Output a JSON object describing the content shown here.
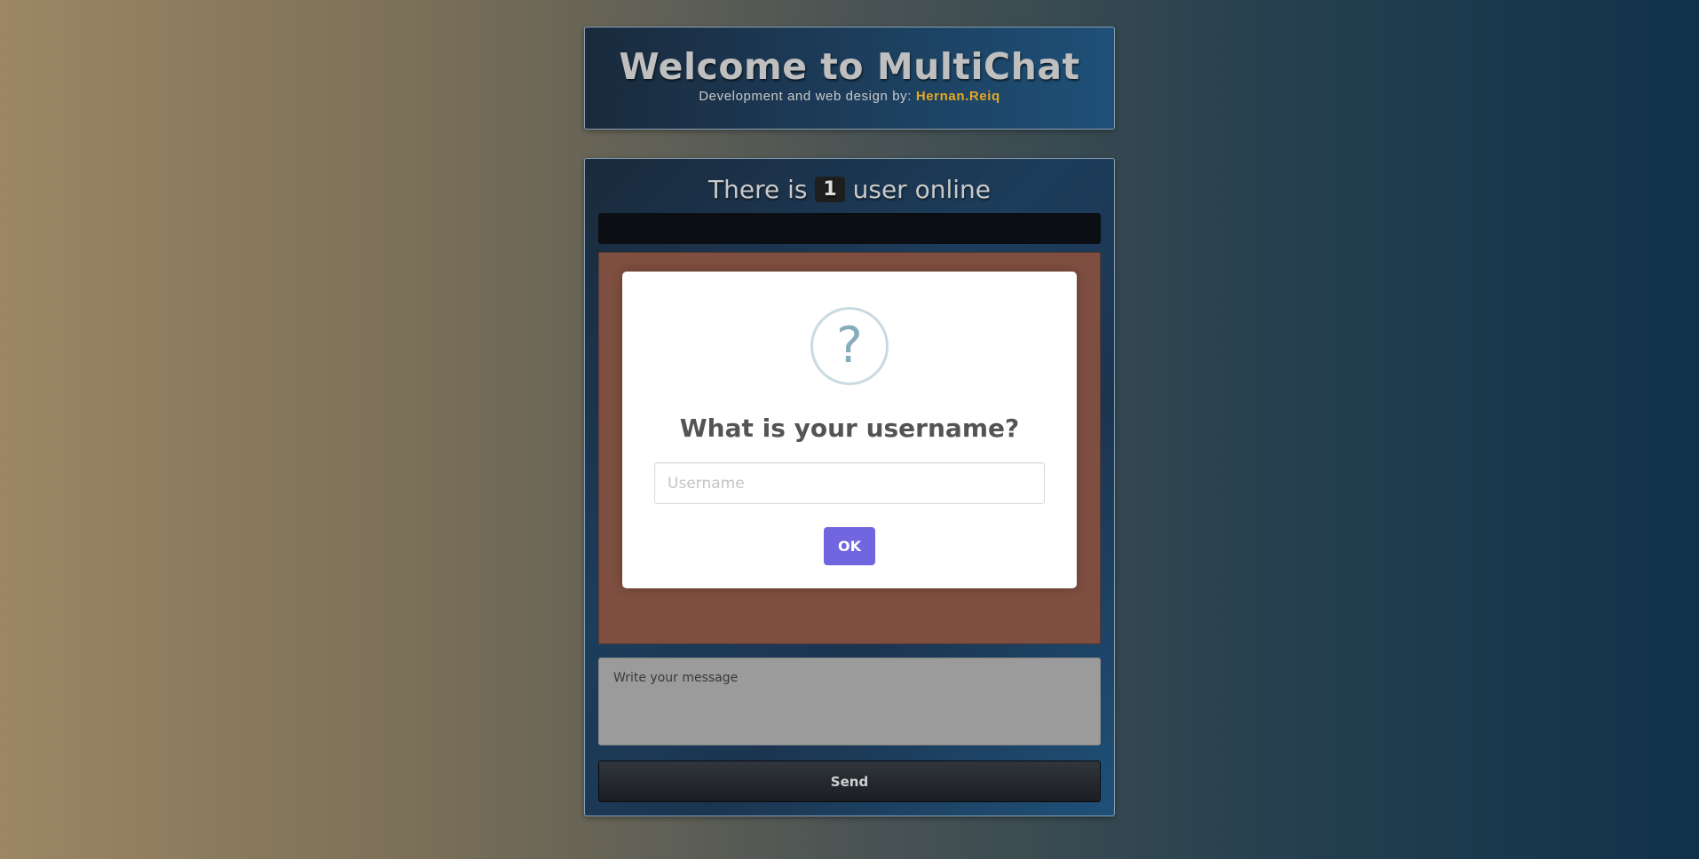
{
  "header": {
    "title": "Welcome to MultiChat",
    "subtitle_prefix": "Development and web design by: ",
    "author": "Hernan.Reiq"
  },
  "status": {
    "prefix": "There is ",
    "count": "1",
    "suffix": " user online"
  },
  "composer": {
    "placeholder": "Write your message",
    "send_label": "Send"
  },
  "modal": {
    "icon": "question-icon",
    "icon_glyph": "?",
    "title": "What is your username?",
    "input_placeholder": "Username",
    "ok_label": "OK"
  },
  "colors": {
    "accent": "#7066e0",
    "author": "#e6a81f",
    "messages_bg": "#7e4f40"
  }
}
